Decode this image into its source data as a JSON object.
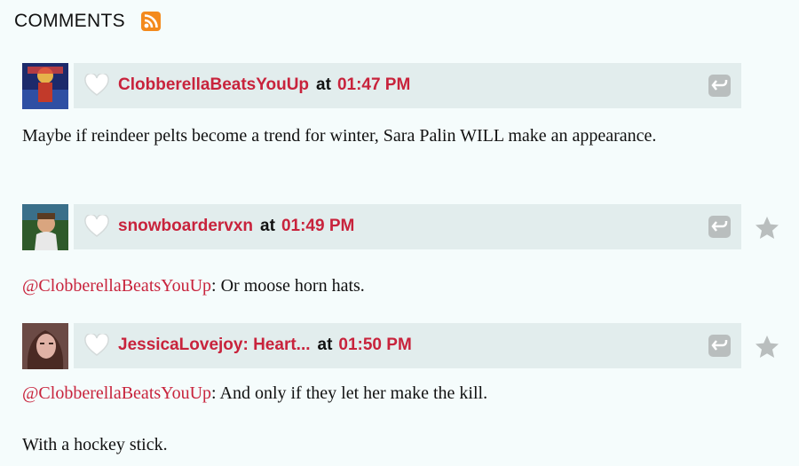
{
  "section": {
    "title": "COMMENTS",
    "rss_icon": "rss-feed-icon"
  },
  "colors": {
    "accent": "#c8233c",
    "meta_bar": "#e2eded",
    "background": "#f5fcfc",
    "icon_gray": "#b9bebe",
    "rss": "#f38a1d"
  },
  "comments": [
    {
      "author": "ClobberellaBeatsYouUp",
      "at_label": "at",
      "time": "01:47 PM",
      "body": [
        "Maybe if reindeer pelts become a trend for winter, Sara Palin WILL make an appearance."
      ]
    },
    {
      "author": "snowboardervxn",
      "at_label": "at",
      "time": "01:49 PM",
      "mention": "@ClobberellaBeatsYouUp",
      "body": [
        ": Or moose horn hats."
      ]
    },
    {
      "author": "JessicaLovejoy: Heart...",
      "at_label": "at",
      "time": "01:50 PM",
      "mention": "@ClobberellaBeatsYouUp",
      "body": [
        ": And only if they let her make the kill.",
        "With a hockey stick."
      ]
    }
  ]
}
